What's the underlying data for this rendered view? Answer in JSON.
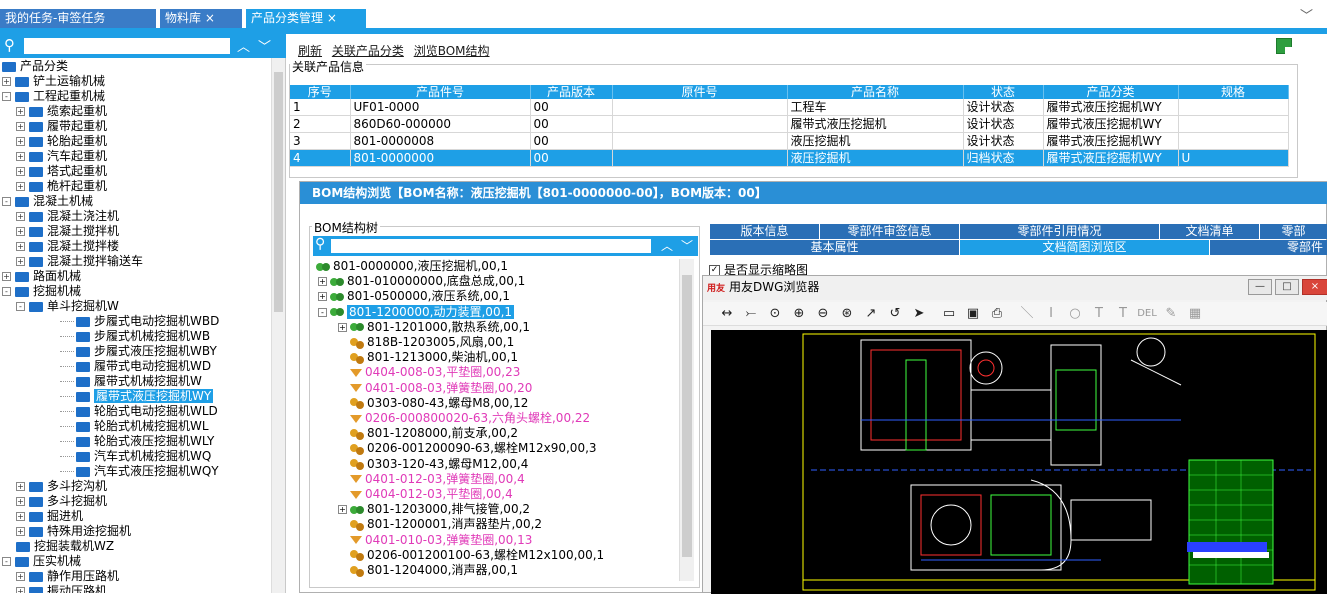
{
  "tabs": [
    {
      "label": "我的任务-审签任务"
    },
    {
      "label": "物料库 ×"
    },
    {
      "label": "产品分类管理 ×"
    }
  ],
  "left_tree": {
    "items": [
      {
        "label": "产品分类",
        "level": 0,
        "expander": "",
        "indent": 0
      },
      {
        "label": "铲土运输机械",
        "level": 1,
        "expander": "+"
      },
      {
        "label": "工程起重机械",
        "level": 1,
        "expander": "-"
      },
      {
        "label": "缆索起重机",
        "level": 2,
        "expander": "+"
      },
      {
        "label": "履带起重机",
        "level": 2,
        "expander": "+"
      },
      {
        "label": "轮胎起重机",
        "level": 2,
        "expander": "+"
      },
      {
        "label": "汽车起重机",
        "level": 2,
        "expander": "+"
      },
      {
        "label": "塔式起重机",
        "level": 2,
        "expander": "+"
      },
      {
        "label": "桅杆起重机",
        "level": 2,
        "expander": "+"
      },
      {
        "label": "混凝土机械",
        "level": 1,
        "expander": "-"
      },
      {
        "label": "混凝土浇注机",
        "level": 2,
        "expander": "+"
      },
      {
        "label": "混凝土搅拌机",
        "level": 2,
        "expander": "+"
      },
      {
        "label": "混凝土搅拌楼",
        "level": 2,
        "expander": "+"
      },
      {
        "label": "混凝土搅拌输送车",
        "level": 2,
        "expander": "+"
      },
      {
        "label": "路面机械",
        "level": 1,
        "expander": "+"
      },
      {
        "label": "挖掘机械",
        "level": 1,
        "expander": "-"
      },
      {
        "label": "单斗挖掘机W",
        "level": 2,
        "expander": "-"
      },
      {
        "label": "步履式电动挖掘机WBD",
        "level": 3,
        "expander": ""
      },
      {
        "label": "步履式机械挖掘机WB",
        "level": 3,
        "expander": ""
      },
      {
        "label": "步履式液压挖掘机WBY",
        "level": 3,
        "expander": ""
      },
      {
        "label": "履带式电动挖掘机WD",
        "level": 3,
        "expander": ""
      },
      {
        "label": "履带式机械挖掘机W",
        "level": 3,
        "expander": ""
      },
      {
        "label": "履带式液压挖掘机WY",
        "level": 3,
        "expander": "",
        "selected": true
      },
      {
        "label": "轮胎式电动挖掘机WLD",
        "level": 3,
        "expander": ""
      },
      {
        "label": "轮胎式机械挖掘机WL",
        "level": 3,
        "expander": ""
      },
      {
        "label": "轮胎式液压挖掘机WLY",
        "level": 3,
        "expander": ""
      },
      {
        "label": "汽车式机械挖掘机WQ",
        "level": 3,
        "expander": ""
      },
      {
        "label": "汽车式液压挖掘机WQY",
        "level": 3,
        "expander": ""
      },
      {
        "label": "多斗挖沟机",
        "level": 2,
        "expander": "+"
      },
      {
        "label": "多斗挖掘机",
        "level": 2,
        "expander": "+"
      },
      {
        "label": "掘进机",
        "level": 2,
        "expander": "+"
      },
      {
        "label": "特殊用途挖掘机",
        "level": 2,
        "expander": "+"
      },
      {
        "label": "挖掘装载机WZ",
        "level": 2,
        "expander": ""
      },
      {
        "label": "压实机械",
        "level": 1,
        "expander": "-"
      },
      {
        "label": "静作用压路机",
        "level": 2,
        "expander": "+"
      },
      {
        "label": "振动压路机",
        "level": 2,
        "expander": "+"
      }
    ]
  },
  "toolbar": {
    "refresh": "刷新",
    "link_category": "关联产品分类",
    "browse_bom": "浏览BOM结构"
  },
  "product_group_title": "关联产品信息",
  "product_table": {
    "headers": [
      "序号",
      "产品件号",
      "产品版本",
      "原件号",
      "产品名称",
      "状态",
      "产品分类",
      "规格"
    ],
    "rows": [
      [
        "1",
        "UF01-0000",
        "00",
        "",
        "工程车",
        "设计状态",
        "履带式液压挖掘机WY",
        ""
      ],
      [
        "2",
        "860D60-000000",
        "00",
        "",
        "履带式液压挖掘机",
        "设计状态",
        "履带式液压挖掘机WY",
        ""
      ],
      [
        "3",
        "801-0000008",
        "00",
        "",
        "液压挖掘机",
        "设计状态",
        "履带式液压挖掘机WY",
        ""
      ],
      [
        "4",
        "801-0000000",
        "00",
        "",
        "液压挖掘机",
        "归档状态",
        "履带式液压挖掘机WY",
        "U"
      ]
    ],
    "selected_row": 3
  },
  "bom_window": {
    "title": "BOM结构浏览【BOM名称：液压挖掘机【801-0000000-00】，BOM版本：00】",
    "tree_title": "BOM结构树",
    "items": [
      {
        "text": "801-0000000,液压挖掘机,00,1",
        "indent": 0,
        "icon": "green",
        "exp": ""
      },
      {
        "text": "801-010000000,底盘总成,00,1",
        "indent": 1,
        "icon": "green",
        "exp": "+"
      },
      {
        "text": "801-0500000,液压系统,00,1",
        "indent": 1,
        "icon": "green",
        "exp": "+"
      },
      {
        "text": "801-1200000,动力装置,00,1",
        "indent": 1,
        "icon": "green",
        "exp": "-",
        "selected": true
      },
      {
        "text": "801-1201000,散热系统,00,1",
        "indent": 2,
        "icon": "green",
        "exp": "+"
      },
      {
        "text": "818B-1203005,风扇,00,1",
        "indent": 2,
        "icon": "orange",
        "exp": ""
      },
      {
        "text": "801-1213000,柴油机,00,1",
        "indent": 2,
        "icon": "orange",
        "exp": ""
      },
      {
        "text": "0404-008-03,平垫圈,00,23",
        "indent": 2,
        "icon": "funnel",
        "exp": "",
        "pink": true
      },
      {
        "text": "0401-008-03,弹簧垫圈,00,20",
        "indent": 2,
        "icon": "funnel",
        "exp": "",
        "pink": true
      },
      {
        "text": "0303-080-43,螺母M8,00,12",
        "indent": 2,
        "icon": "orange",
        "exp": ""
      },
      {
        "text": "0206-000800020-63,六角头螺栓,00,22",
        "indent": 2,
        "icon": "funnel",
        "exp": "",
        "pink": true
      },
      {
        "text": "801-1208000,前支承,00,2",
        "indent": 2,
        "icon": "orange",
        "exp": ""
      },
      {
        "text": "0206-001200090-63,螺栓M12x90,00,3",
        "indent": 2,
        "icon": "orange",
        "exp": ""
      },
      {
        "text": "0303-120-43,螺母M12,00,4",
        "indent": 2,
        "icon": "orange",
        "exp": ""
      },
      {
        "text": "0401-012-03,弹簧垫圈,00,4",
        "indent": 2,
        "icon": "funnel",
        "exp": "",
        "pink": true
      },
      {
        "text": "0404-012-03,平垫圈,00,4",
        "indent": 2,
        "icon": "funnel",
        "exp": "",
        "pink": true
      },
      {
        "text": "801-1203000,排气接管,00,2",
        "indent": 2,
        "icon": "green",
        "exp": "+"
      },
      {
        "text": "801-1200001,消声器垫片,00,2",
        "indent": 2,
        "icon": "orange",
        "exp": ""
      },
      {
        "text": "0401-010-03,弹簧垫圈,00,13",
        "indent": 2,
        "icon": "funnel",
        "exp": "",
        "pink": true
      },
      {
        "text": "0206-001200100-63,螺栓M12x100,00,1",
        "indent": 2,
        "icon": "orange",
        "exp": ""
      },
      {
        "text": "801-1204000,消声器,00,1",
        "indent": 2,
        "icon": "orange",
        "exp": ""
      }
    ],
    "tabs_row1": [
      "版本信息",
      "零部件审签信息",
      "零部件引用情况",
      "文档清单",
      "零部"
    ],
    "tabs_row2": [
      "基本属性",
      "文档简图浏览区",
      "零部件"
    ],
    "show_thumbnail_label": "是否显示缩略图",
    "show_thumbnail_checked": true
  },
  "dwg_viewer": {
    "logo": "用友",
    "title": "用友DWG浏览器",
    "toolbar_icons": [
      "pan-icon",
      "measure-icon",
      "zoom-window-icon",
      "zoom-in-icon",
      "zoom-out-icon",
      "zoom-extents-icon",
      "zoom-realtime-icon",
      "zoom-previous-icon",
      "select-icon",
      "open-icon",
      "preview-icon",
      "print-icon",
      "line-icon",
      "text-tool-icon",
      "circle-icon",
      "text-icon",
      "dim-text-icon",
      "delete-icon",
      "edit-icon",
      "save-icon"
    ],
    "toolbar_text_labels": {
      "t1": "T",
      "t2": "T",
      "del": "DEL"
    }
  },
  "colors": {
    "accent": "#1e9fe6",
    "tab_inactive": "#3a7cc7",
    "pink_text": "#e03ab8",
    "cad_bg": "#000000"
  }
}
